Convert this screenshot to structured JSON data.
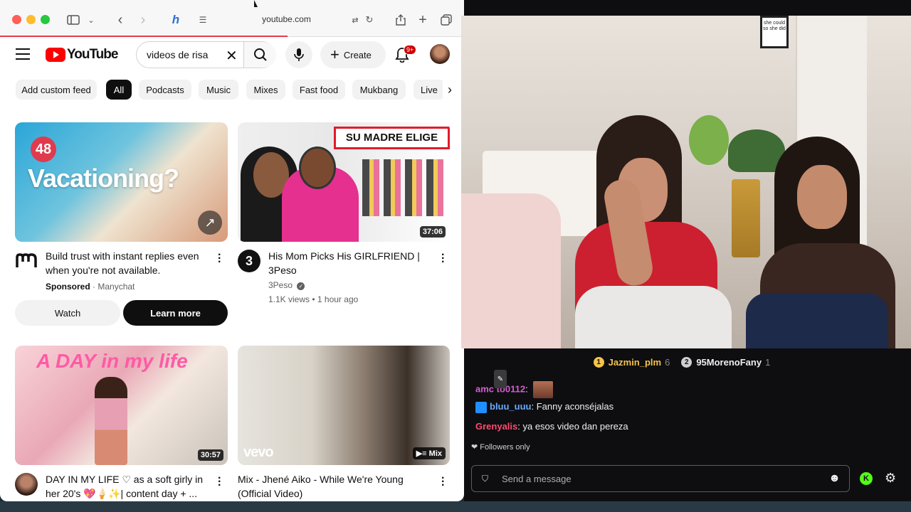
{
  "browser": {
    "url": "youtube.com",
    "traffic_colors": [
      "#ff5f57",
      "#febc2e",
      "#28c840"
    ]
  },
  "youtube": {
    "logo_text": "YouTube",
    "search_value": "videos de risa",
    "create_label": "Create",
    "notif_badge": "9+",
    "chips": [
      "Add custom feed",
      "All",
      "Podcasts",
      "Music",
      "Mixes",
      "Fast food",
      "Mukbang",
      "Live"
    ],
    "active_chip": "All",
    "videos": [
      {
        "thumb_number": "48",
        "thumb_headline": "Vacationing?",
        "title_line1": "Build trust with instant replies even",
        "title_line2": "when you're not available.",
        "sponsored_label": "Sponsored",
        "meta_sep": "·",
        "channel": "Manychat",
        "watch_label": "Watch",
        "learn_label": "Learn more"
      },
      {
        "thumb_banner": "SU MADRE ELIGE",
        "duration": "37:06",
        "channel_initial": "3",
        "title_line1": "His Mom Picks His GIRLFRIEND |",
        "title_line2": "3Peso",
        "channel": "3Peso",
        "views": "1.1K views",
        "age": "1 hour ago"
      },
      {
        "thumb_headline": "A DAY in my life",
        "duration": "30:57",
        "title_line1": "DAY IN MY LIFE ♡ as a soft girly in",
        "title_line2": "her 20's 💖🍦✨| content day + ..."
      },
      {
        "thumb_brand": "vevo",
        "mix_badge": "Mix",
        "title_line1": "Mix - Jhené Aiko - While We're Young",
        "title_line2": "(Official Video)"
      }
    ]
  },
  "stream": {
    "wall_art_text": "she could so she did",
    "leaderboard": [
      {
        "rank": "1",
        "name": "Jazmin_plm",
        "count": "6",
        "color": "#f5c24b"
      },
      {
        "rank": "2",
        "name": "95MorenoFany",
        "count": "1",
        "color": "#cfcfcf"
      }
    ],
    "chat": [
      {
        "user": "amc to0112",
        "user_color": "#d65cd6",
        "text": ""
      },
      {
        "user": "bluu_uuu",
        "user_color": "#6aa9ff",
        "text": ": Fanny aconséjalas"
      },
      {
        "user": "Grenyalis",
        "user_color": "#ff4b6e",
        "text": ": ya esos video dan pereza"
      }
    ],
    "followers_only": "Followers only",
    "message_placeholder": "Send a message",
    "accent_green": "#53fc18"
  }
}
